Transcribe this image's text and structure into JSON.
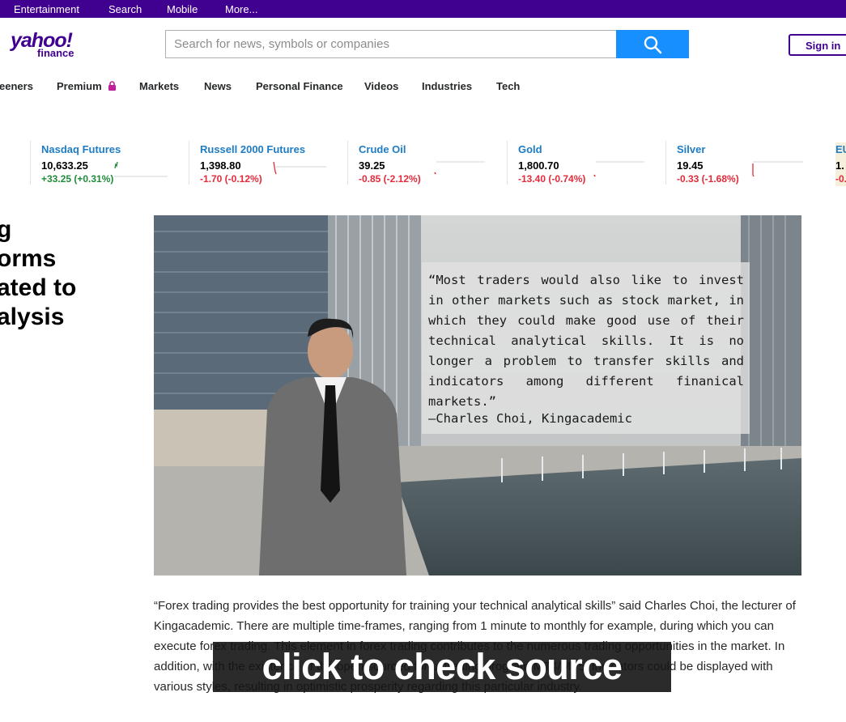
{
  "topnav": [
    "Entertainment",
    "Search",
    "Mobile",
    "More..."
  ],
  "logo": {
    "main": "yahoo!",
    "sub": "finance"
  },
  "search": {
    "placeholder": "Search for news, symbols or companies"
  },
  "signin_label": "Sign in",
  "nav": [
    "eeners",
    "Premium",
    "Markets",
    "News",
    "Personal Finance",
    "Videos",
    "Industries",
    "Tech"
  ],
  "tickers": [
    {
      "name": "Nasdaq Futures",
      "price": "10,633.25",
      "change": "+33.25 (+0.31%)",
      "direction": "up"
    },
    {
      "name": "Russell 2000 Futures",
      "price": "1,398.80",
      "change": "-1.70 (-0.12%)",
      "direction": "down"
    },
    {
      "name": "Crude Oil",
      "price": "39.25",
      "change": "-0.85 (-2.12%)",
      "direction": "down"
    },
    {
      "name": "Gold",
      "price": "1,800.70",
      "change": "-13.40 (-0.74%)",
      "direction": "down"
    },
    {
      "name": "Silver",
      "price": "19.45",
      "change": "-0.33 (-1.68%)",
      "direction": "down"
    },
    {
      "name": "EU",
      "price": "1.",
      "change": "-0.",
      "direction": "down"
    }
  ],
  "headline_lines": [
    "g",
    "orms",
    "ated to",
    "alysis"
  ],
  "hero_quote": {
    "text": "“Most traders would also like to invest in other markets such as stock market, in which they could make good use of their technical analytical skills. It is no longer a problem to transfer skills and indicators among different finanical markets.”",
    "author": "–Charles Choi, Kingacademic"
  },
  "body_text": "“Forex trading provides the best opportunity for training your technical analytical skills” said Charles Choi, the lecturer of Kingacademic. There are multiple time-frames, ranging from 1 minute to monthly for example, during which you can execute forex trading. This element in forex trading contributes to the numerous trading opportunities in the market. In addition, with the existence of the open sourced forex trading program MT4/MT5, indicators could be displayed with various styles, resulting in optimistic prosperity regarding this particular industry.",
  "overlay_label": "click to check source",
  "colors": {
    "brand": "#400090",
    "search_button": "#188fff",
    "up": "#1e8c3a",
    "down": "#e32b3a",
    "link": "#1d7cc4"
  }
}
